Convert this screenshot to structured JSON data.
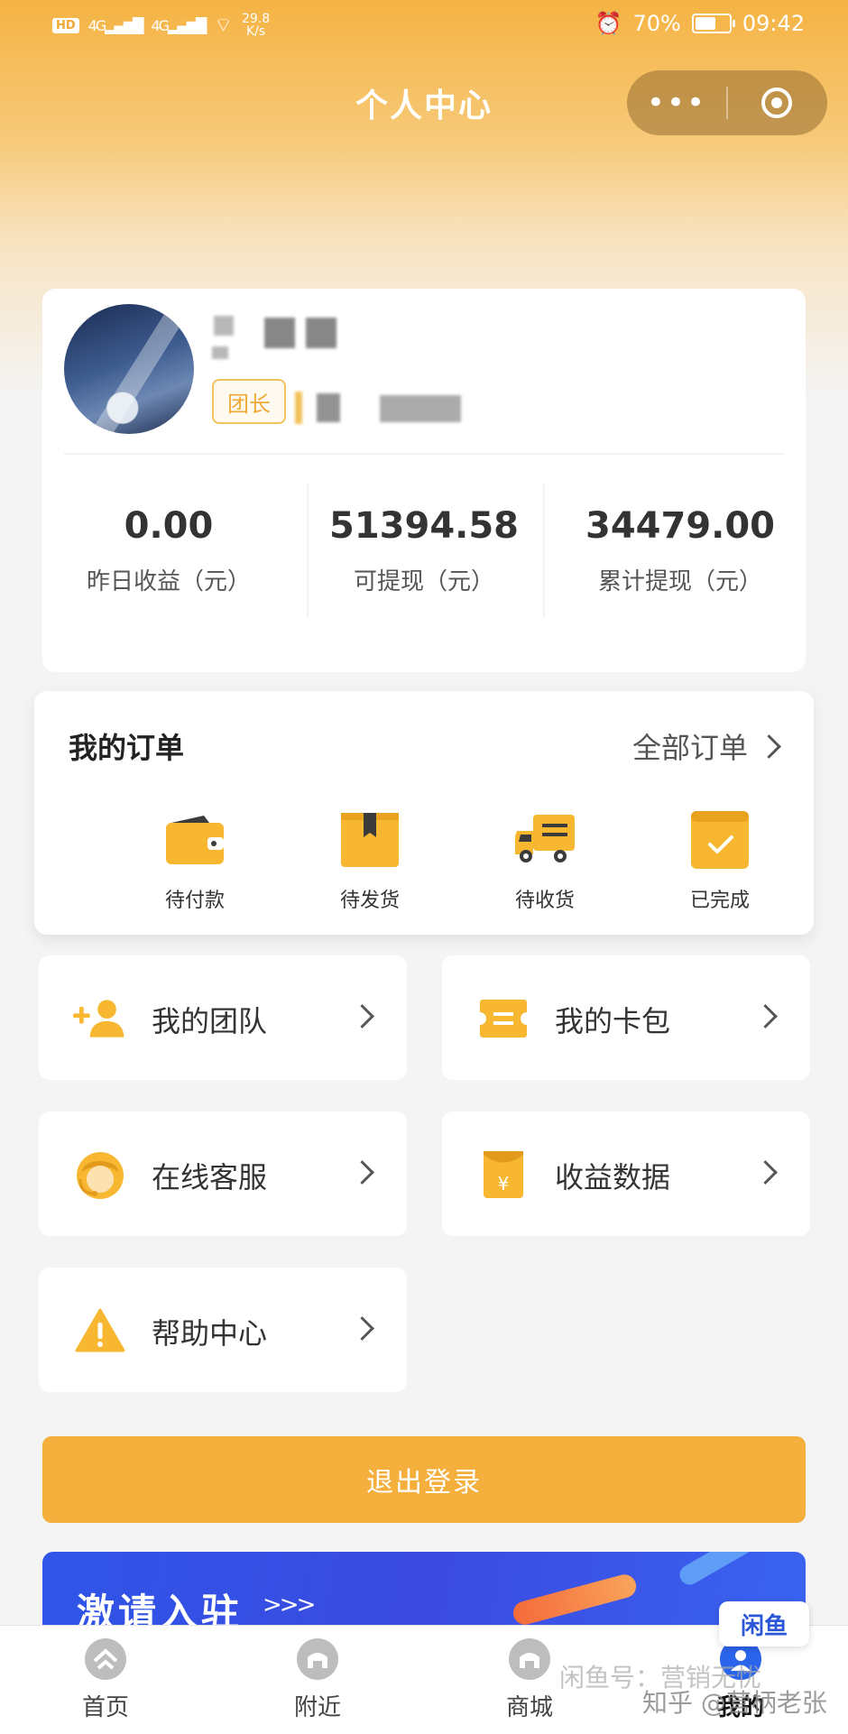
{
  "status_bar": {
    "network_badge": "HD",
    "sim1": "4G",
    "sim2": "4G",
    "speed": "29.8",
    "speed_unit": "K/s",
    "battery": "70%",
    "battery_level": 0.7,
    "time": "09:42"
  },
  "header": {
    "title": "个人中心",
    "menu_glyph": "•••",
    "colors": {
      "accent": "#f4af3d"
    }
  },
  "profile": {
    "role_badge": "团长",
    "stats": [
      {
        "value": "0.00",
        "label": "昨日收益（元）"
      },
      {
        "value": "51394.58",
        "label": "可提现（元）"
      },
      {
        "value": "34479.00",
        "label": "累计提现（元）"
      }
    ]
  },
  "orders": {
    "title": "我的订单",
    "all_label": "全部订单",
    "items": [
      {
        "label": "待付款",
        "icon": "wallet-icon"
      },
      {
        "label": "待发货",
        "icon": "package-icon"
      },
      {
        "label": "待收货",
        "icon": "truck-icon"
      },
      {
        "label": "已完成",
        "icon": "check-box-icon"
      }
    ]
  },
  "menu": [
    {
      "label": "我的团队",
      "icon": "add-user-icon"
    },
    {
      "label": "我的卡包",
      "icon": "card-icon"
    },
    {
      "label": "在线客服",
      "icon": "customer-service-icon"
    },
    {
      "label": "收益数据",
      "icon": "income-icon"
    },
    {
      "label": "帮助中心",
      "icon": "warning-icon"
    }
  ],
  "logout_label": "退出登录",
  "banner": {
    "title": "激请入驻",
    "arrows": ">>>"
  },
  "tabs": [
    {
      "label": "首页"
    },
    {
      "label": "附近"
    },
    {
      "label": "商城"
    },
    {
      "label": "我的"
    }
  ],
  "watermark": {
    "zhihu": "知乎 @营柄老张",
    "xianyu": "闲鱼号：营销无忧"
  }
}
